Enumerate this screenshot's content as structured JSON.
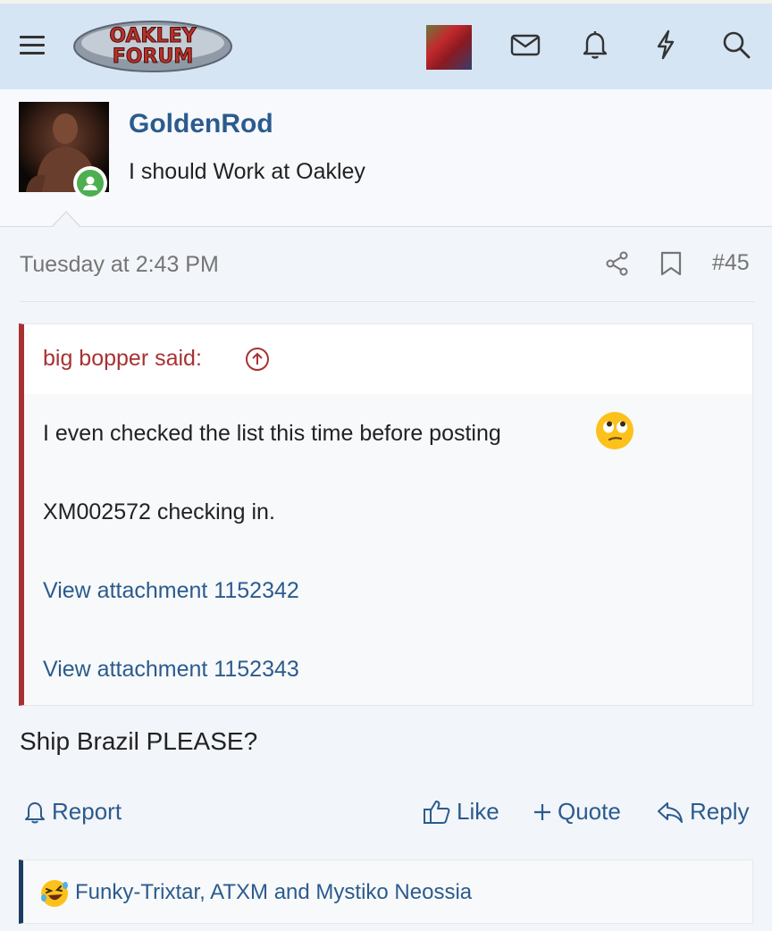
{
  "header": {
    "logo_line1": "OAKLEY",
    "logo_line2": "FORUM",
    "icons": [
      "menu-icon",
      "envelope-icon",
      "bell-icon",
      "lightning-icon",
      "search-icon"
    ]
  },
  "post": {
    "author": "GoldenRod",
    "author_title": "I should Work at Oakley",
    "date": "Tuesday at 2:43 PM",
    "number": "#45",
    "quote": {
      "author_label": "big bopper said:",
      "line1": "I even checked the list this time before posting",
      "line2": "XM002572 checking in.",
      "attachment1": "View attachment 1152342",
      "attachment2": "View attachment 1152343"
    },
    "message": "Ship Brazil PLEASE?"
  },
  "actions": {
    "report": "Report",
    "like": "Like",
    "quote": "Quote",
    "reply": "Reply"
  },
  "reactions": {
    "users": "Funky-Trixtar, ATXM and Mystiko Neossia"
  },
  "colors": {
    "header_bg": "#d6e5f4",
    "link": "#2b5b8e",
    "quote_accent": "#a83232",
    "reaction_accent": "#1d3c61",
    "online": "#4caf50"
  }
}
